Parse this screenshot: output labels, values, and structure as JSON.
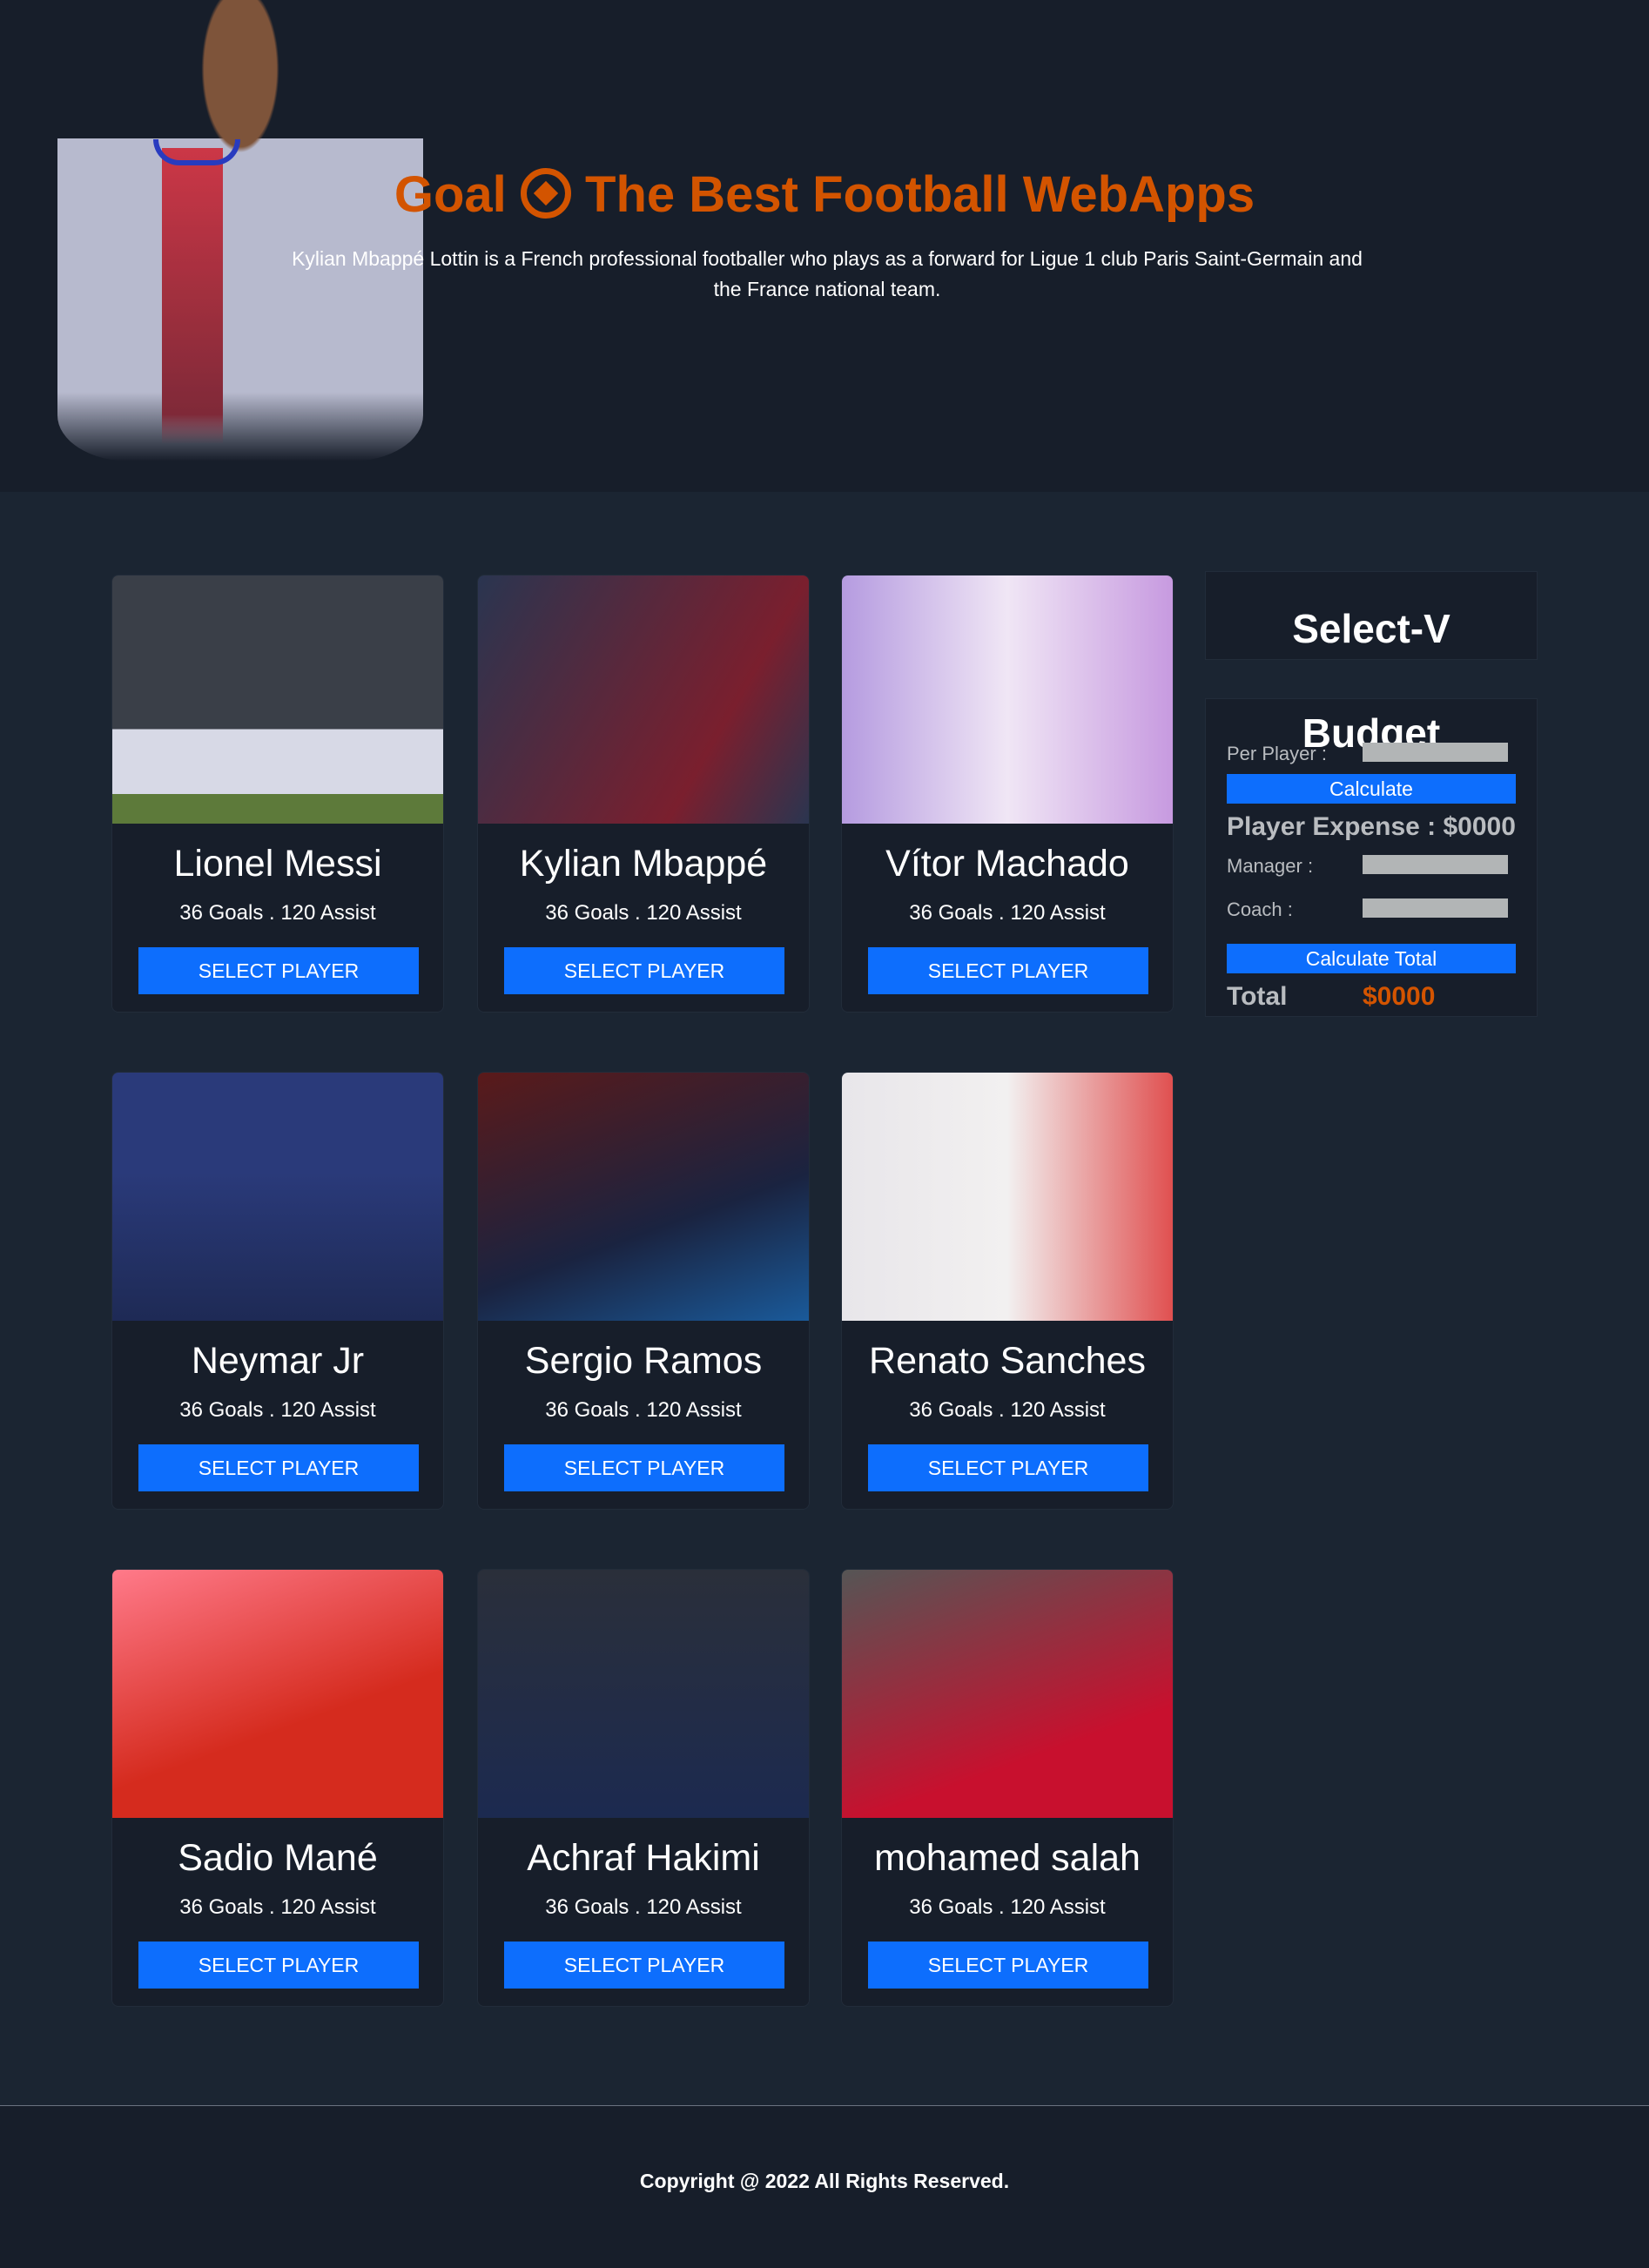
{
  "header": {
    "title_pre": "Goal",
    "title_post": "The Best Football WebApps",
    "icon": "football-icon",
    "description": "Kylian Mbappé Lottin is a French professional footballer who plays as a forward for Ligue 1 club Paris Saint-Germain and the France national team."
  },
  "players": [
    {
      "name": "Lionel Messi",
      "stats": "36 Goals . 120 Assist",
      "button": "SELECT PLAYER"
    },
    {
      "name": "Kylian Mbappé",
      "stats": "36 Goals . 120 Assist",
      "button": "SELECT PLAYER"
    },
    {
      "name": "Vítor Machado",
      "stats": "36 Goals . 120 Assist",
      "button": "SELECT PLAYER"
    },
    {
      "name": "Neymar Jr",
      "stats": "36 Goals . 120 Assist",
      "button": "SELECT PLAYER"
    },
    {
      "name": "Sergio Ramos",
      "stats": "36 Goals . 120 Assist",
      "button": "SELECT PLAYER"
    },
    {
      "name": "Renato Sanches",
      "stats": "36 Goals . 120 Assist",
      "button": "SELECT PLAYER"
    },
    {
      "name": "Sadio Mané",
      "stats": "36 Goals . 120 Assist",
      "button": "SELECT PLAYER"
    },
    {
      "name": "Achraf Hakimi",
      "stats": "36 Goals . 120 Assist",
      "button": "SELECT PLAYER"
    },
    {
      "name": "mohamed salah",
      "stats": "36 Goals . 120 Assist",
      "button": "SELECT PLAYER"
    }
  ],
  "sidebar": {
    "selected_title": "Select-V",
    "budget": {
      "title": "Budget",
      "per_player_label": "Per Player :",
      "per_player_value": "",
      "calculate": "Calculate",
      "player_expense": "Player Expense : $0000",
      "manager_label": "Manager :",
      "manager_value": "",
      "coach_label": "Coach :",
      "coach_value": "",
      "calculate_total": "Calculate Total",
      "total_label": "Total",
      "total_value": "$0000"
    }
  },
  "footer": {
    "copyright": "Copyright @ 2022 All Rights Reserved."
  },
  "colors": {
    "accent": "#d35400",
    "button": "#0d6efd",
    "header_bg": "#171e2a",
    "body_bg": "#1b2532"
  }
}
